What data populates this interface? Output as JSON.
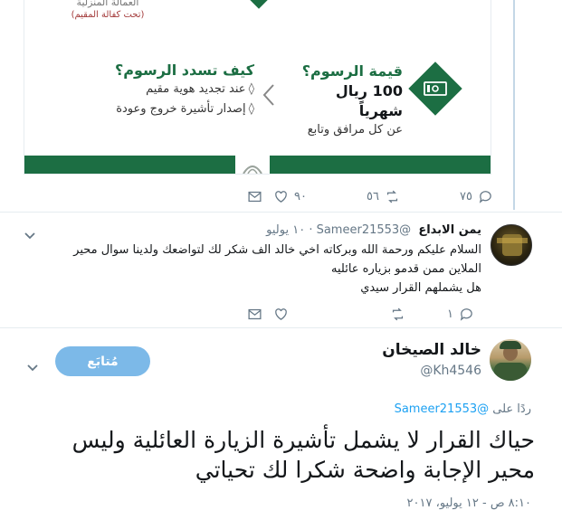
{
  "card": {
    "top_line1": "العمالة المنزلية",
    "top_line2": "(تحت كفالة المقيم)",
    "pay_title": "كيف تسدد الرسوم؟",
    "pay_items": [
      "عند تجديد هوية مقيم",
      "إصدار تأشيرة خروج وعودة"
    ],
    "fee_title": "قيمة الرسوم؟",
    "fee_amount": "100 ريال شهرياً",
    "fee_note": "عن كل مرافق وتابع",
    "brand_color": "#1c6e43"
  },
  "tweet1_actions": {
    "reply_count": "٧٥",
    "retweet_count": "٥٦",
    "like_count": "٩٠"
  },
  "reply": {
    "name": "يمن الابداع",
    "handle": "@Sameer21553",
    "time": "١٠ يوليو",
    "lines": [
      "السلام عليكم ورحمة الله وبركاته اخي خالد الف شكر لك لتواضعك ولدينا سوال محير",
      "الملاين ممن قدمو بزياره عائليه",
      "هل يشملهم القرار سيدي"
    ],
    "reply_count": "١"
  },
  "main": {
    "name": "خالد الصيخان",
    "handle": "@Kh4546",
    "follow_label": "مُتابَع",
    "reply_to_label": "ردًا على",
    "reply_to_handle": "@Sameer21553",
    "text_lines": [
      "حياك القرار لا يشمل تأشيرة الزيارة العائلية وليس",
      "محير الإجابة واضحة شكرا لك تحياتي"
    ],
    "date": "٨:١٠ ص - ١٢ يوليو، ٢٠١٧"
  },
  "colors": {
    "accent": "#1da1f2",
    "follow_button": "#7cb9e8",
    "muted_text": "#657786",
    "thread_line": "#c4d7e6"
  }
}
